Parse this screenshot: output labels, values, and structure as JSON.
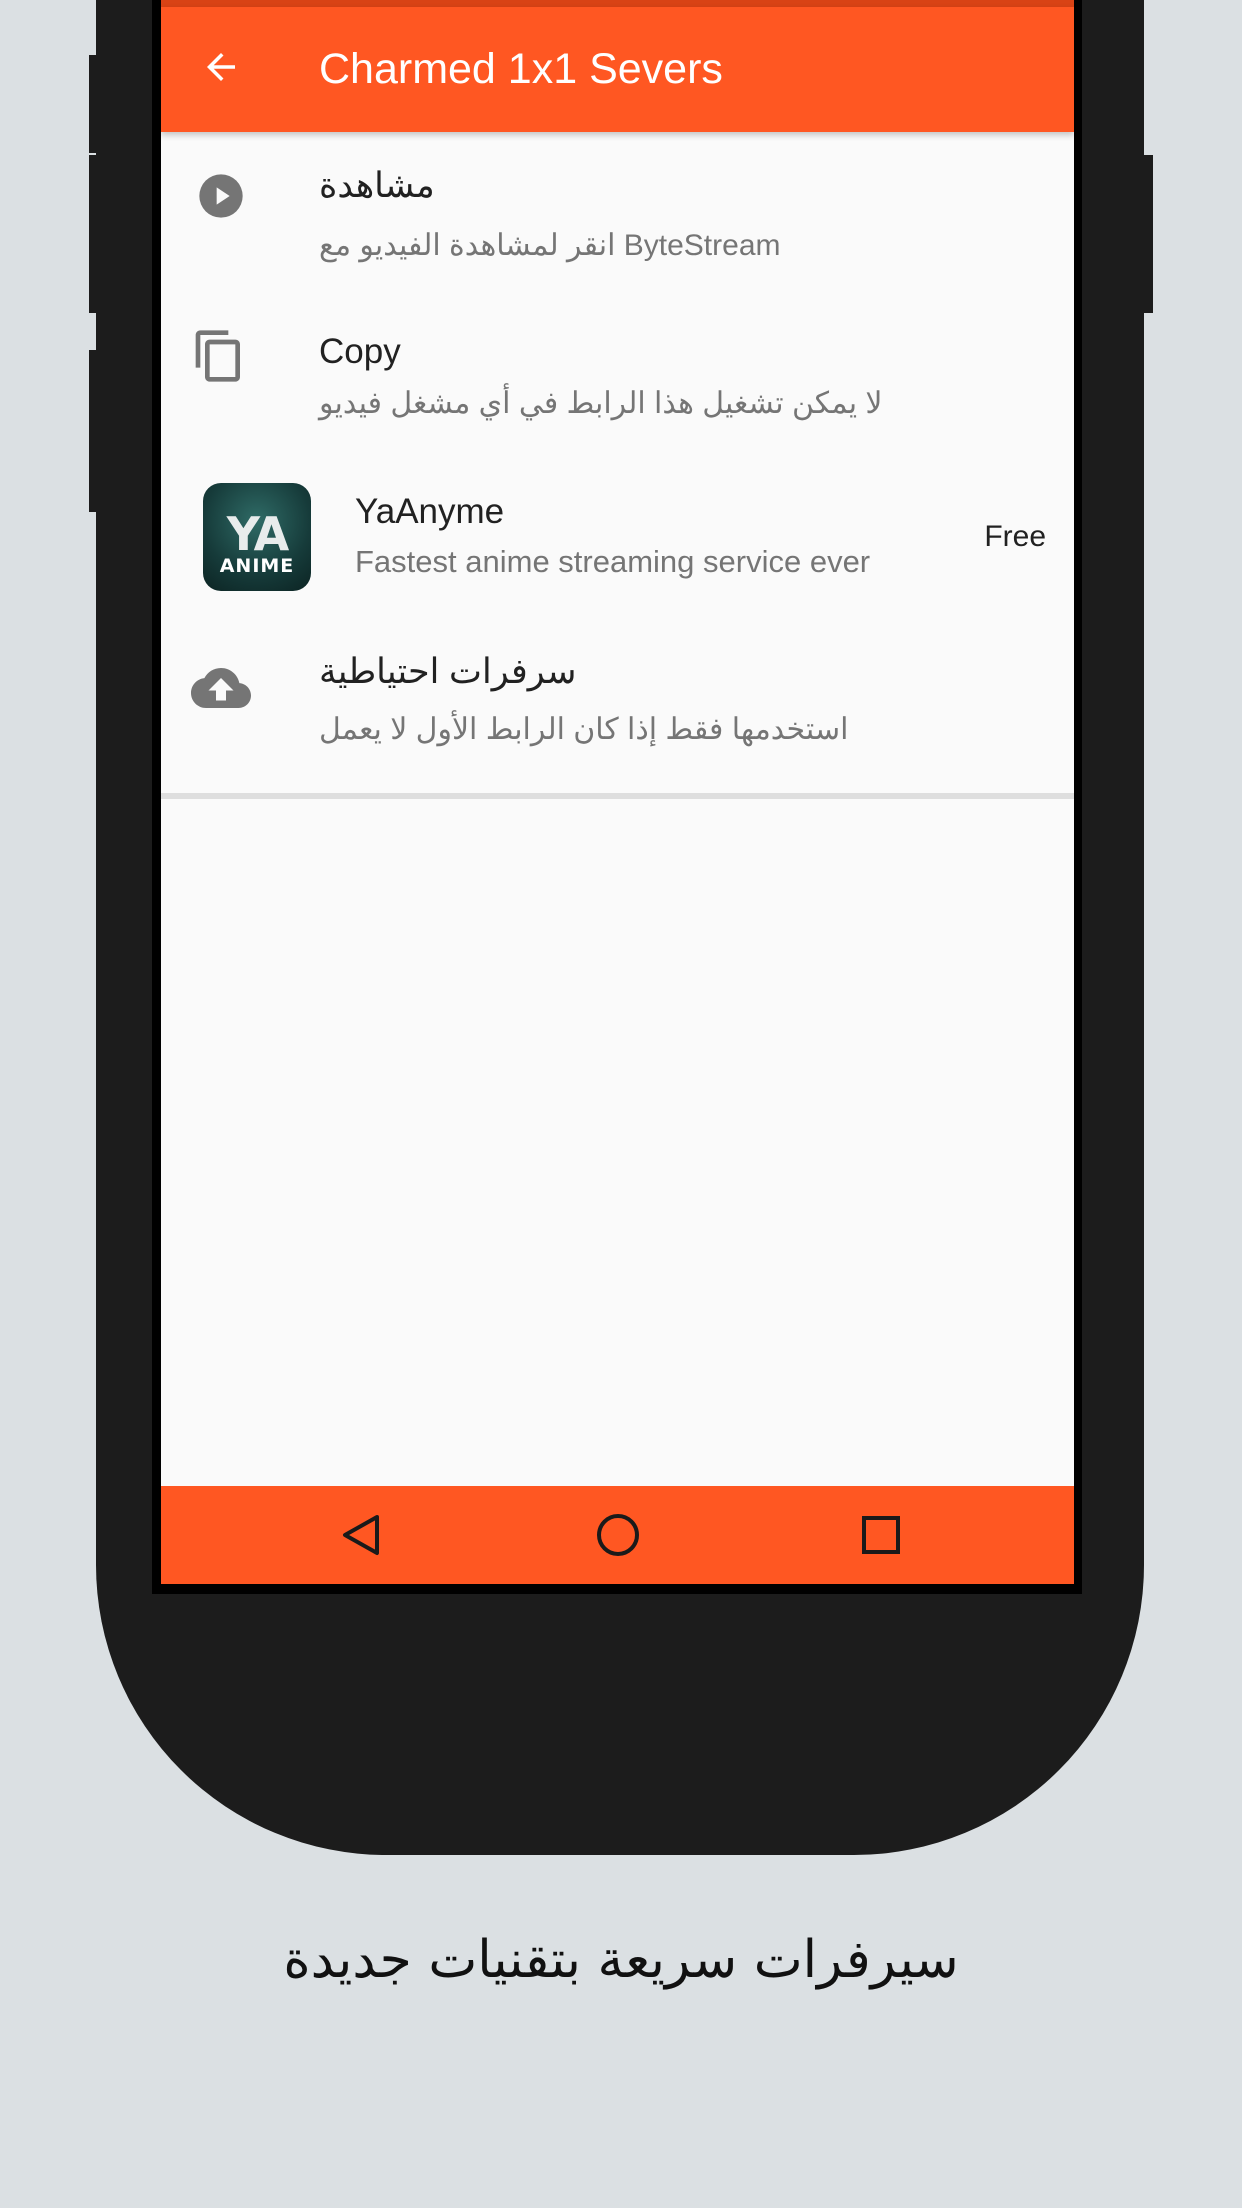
{
  "app_bar": {
    "title": "Charmed 1x1 Severs",
    "back_icon": "arrow-back-icon",
    "color": "#ff5722"
  },
  "items": [
    {
      "icon": "play-circle-icon",
      "title": "مشاهدة",
      "subtitle": "انقر لمشاهدة الفيديو مع ByteStream"
    },
    {
      "icon": "copy-icon",
      "title": "Copy",
      "subtitle": "لا يمكن تشغيل هذا الرابط في أي مشغل فيديو"
    },
    {
      "icon": "app-logo",
      "title": "YaAnyme",
      "subtitle": "Fastest anime streaming service ever",
      "price": "Free",
      "logo_text_top": "YA",
      "logo_text_bottom": "ANIME"
    },
    {
      "icon": "cloud-upload-icon",
      "title": "سرفرات احتياطية",
      "subtitle": "استخدمها فقط إذا كان الرابط الأول لا يعمل"
    }
  ],
  "nav_bar": {
    "back_icon": "nav-back-icon",
    "home_icon": "nav-home-icon",
    "recents_icon": "nav-recents-icon"
  },
  "caption": "سيرفرات سريعة بتقنيات جديدة"
}
